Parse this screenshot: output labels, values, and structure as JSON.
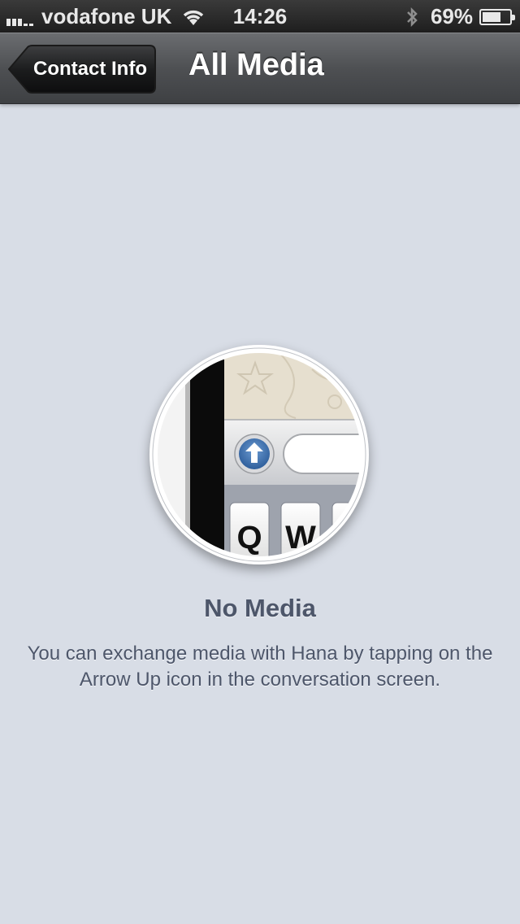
{
  "status_bar": {
    "carrier": "vodafone UK",
    "time": "14:26",
    "battery_percent": "69%",
    "battery_level": 0.69,
    "signal_bars": 3,
    "icons": [
      "signal-icon",
      "wifi-icon",
      "bluetooth-icon",
      "battery-icon"
    ]
  },
  "nav_bar": {
    "back_label": "Contact Info",
    "title": "All Media"
  },
  "empty_state": {
    "illustration": "magnifier-lens-illustration",
    "illustration_keys": [
      "Q",
      "W"
    ],
    "title": "No Media",
    "description": "You can exchange media with Hana by tapping on the Arrow Up icon in the conversation screen."
  },
  "colors": {
    "background": "#d8dde6",
    "text": "#4d566a",
    "nav_bar": "#505255",
    "arrow_button": "#3d6fad"
  }
}
